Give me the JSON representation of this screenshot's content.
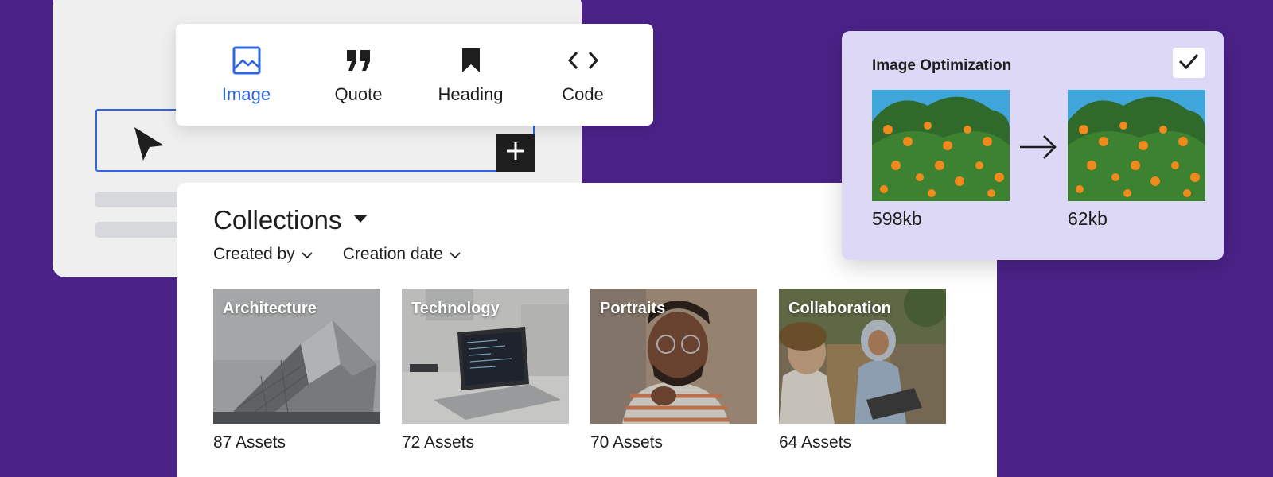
{
  "editor": {
    "add_block_icon": "plus-icon",
    "cursor_icon": "pointer-cursor-icon"
  },
  "inserter": {
    "items": [
      {
        "label": "Image",
        "icon": "image-icon",
        "active": true
      },
      {
        "label": "Quote",
        "icon": "quote-icon",
        "active": false
      },
      {
        "label": "Heading",
        "icon": "bookmark-icon",
        "active": false
      },
      {
        "label": "Code",
        "icon": "code-icon",
        "active": false
      }
    ],
    "active_color": "#2f66e0"
  },
  "collections": {
    "title": "Collections",
    "filters": [
      {
        "label": "Created by"
      },
      {
        "label": "Creation date"
      }
    ],
    "tiles": [
      {
        "name": "Architecture",
        "count": "87 Assets"
      },
      {
        "name": "Technology",
        "count": "72 Assets"
      },
      {
        "name": "Portraits",
        "count": "70 Assets"
      },
      {
        "name": "Collaboration",
        "count": "64 Assets"
      }
    ]
  },
  "optimization": {
    "title": "Image Optimization",
    "before_size": "598kb",
    "after_size": "62kb",
    "checked": true
  },
  "colors": {
    "background": "#4b2288",
    "optimization_card": "#ddd8f5",
    "accent": "#2f66e0"
  }
}
